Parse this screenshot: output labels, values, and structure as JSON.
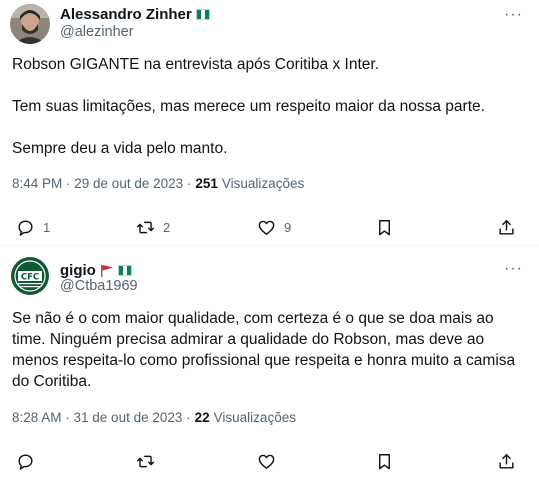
{
  "tweets": [
    {
      "author": "Alessandro Zinher",
      "handle": "@alezinher",
      "paragraphs": [
        "Robson GIGANTE na entrevista após Coritiba x Inter.",
        "Tem suas limitações, mas merece um respeito maior da nossa parte.",
        "Sempre deu a vida pelo manto."
      ],
      "time": "8:44 PM · 29 de out de 2023 ·",
      "views_count": "251",
      "views_label": "Visualizações",
      "replies": "1",
      "retweets": "2",
      "likes": "9"
    },
    {
      "author": "gigio",
      "handle": "@Ctba1969",
      "avatar_text": "CFC",
      "paragraphs": [
        "Se não é o com maior qualidade, com certeza é o que se doa mais ao time. Ninguém precisa admirar a qualidade do Robson, mas deve ao menos respeita-lo como profissional que respeita e honra muito a camisa do Coritiba."
      ],
      "time": "8:28 AM · 31 de out de 2023 ·",
      "views_count": "22",
      "views_label": "Visualizações"
    }
  ],
  "icons": [
    "nigeria-flag-icon",
    "red-flag-icon",
    "more-icon",
    "reply-icon",
    "retweet-icon",
    "like-icon",
    "bookmark-icon",
    "share-icon"
  ],
  "colors": {
    "secondary_text": "#536471",
    "primary_text": "#0f1419",
    "divider": "#eff3f4"
  }
}
